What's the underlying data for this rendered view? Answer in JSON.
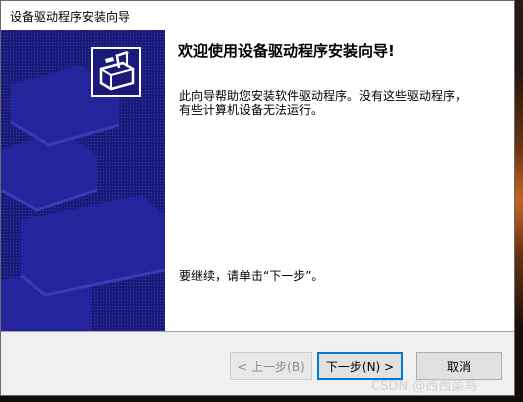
{
  "window": {
    "title": "设备驱动程序安装向导"
  },
  "main": {
    "heading": "欢迎使用设备驱动程序安装向导!",
    "description": "此向导帮助您安装软件驱动程序。没有这些驱动程序，有些计算机设备无法运行。",
    "continue_hint": "要继续，请单击“下一步”。"
  },
  "buttons": {
    "back_label": "< 上一步(B)",
    "next_label": "下一步(N) >",
    "cancel_label": "取消"
  },
  "watermark": "CSDN @西西菜鸟",
  "colors": {
    "side_panel": "#1a1a7a",
    "focus_border": "#0078d7"
  },
  "icons": {
    "wizard": "device-driver-install-icon"
  }
}
